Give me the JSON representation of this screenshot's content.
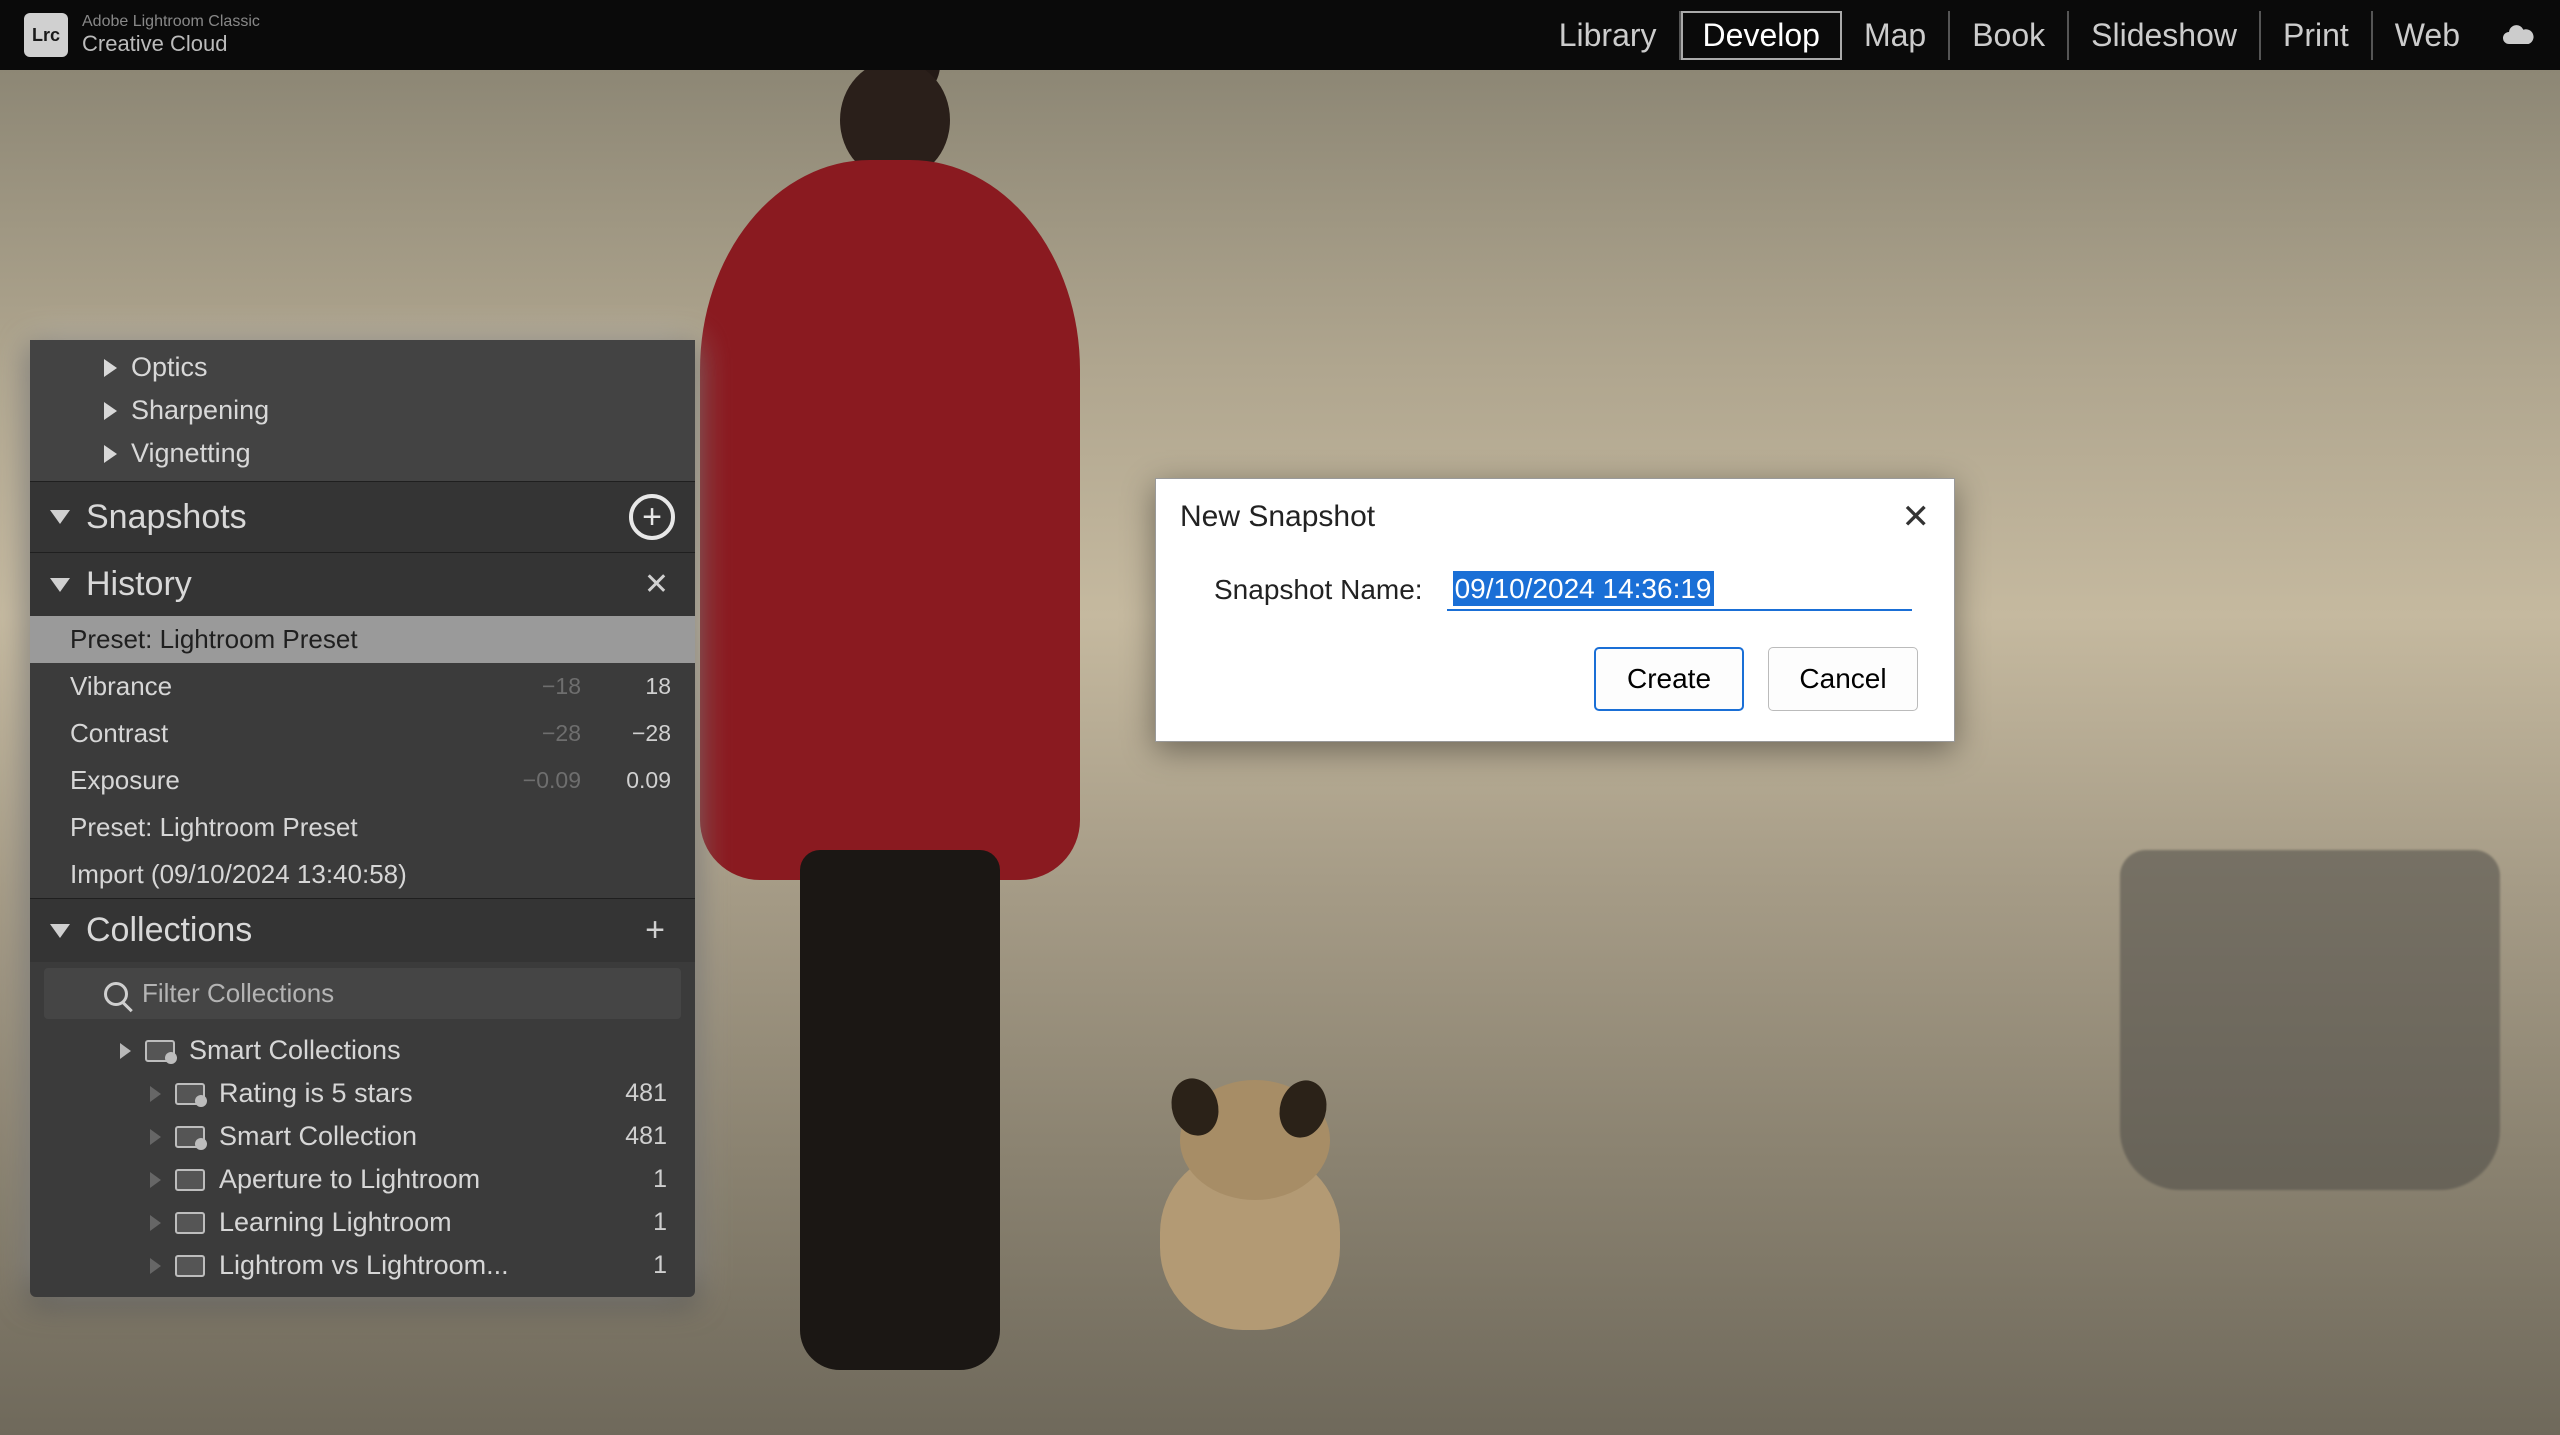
{
  "app": {
    "icon_label": "Lrc",
    "title_top": "Adobe Lightroom Classic",
    "title_bottom": "Creative Cloud"
  },
  "modules": {
    "items": [
      "Library",
      "Develop",
      "Map",
      "Book",
      "Slideshow",
      "Print",
      "Web"
    ],
    "active": "Develop"
  },
  "panel_top": {
    "items": [
      "Optics",
      "Sharpening",
      "Vignetting"
    ]
  },
  "snapshots": {
    "title": "Snapshots"
  },
  "history": {
    "title": "History",
    "items": [
      {
        "label": "Preset: Lightroom Preset",
        "v1": "",
        "v2": "",
        "selected": true
      },
      {
        "label": "Vibrance",
        "v1": "−18",
        "v2": "18"
      },
      {
        "label": "Contrast",
        "v1": "−28",
        "v2": "−28"
      },
      {
        "label": "Exposure",
        "v1": "−0.09",
        "v2": "0.09"
      },
      {
        "label": "Preset: Lightroom Preset",
        "v1": "",
        "v2": ""
      },
      {
        "label": "Import (09/10/2024 13:40:58)",
        "v1": "",
        "v2": ""
      }
    ]
  },
  "collections": {
    "title": "Collections",
    "filter_placeholder": "Filter Collections",
    "items": [
      {
        "name": "Smart Collections",
        "count": "",
        "icon": "smart",
        "arrow": "solid",
        "indent": 0
      },
      {
        "name": "Rating is 5 stars",
        "count": "481",
        "icon": "smart",
        "arrow": "dim",
        "indent": 1
      },
      {
        "name": "Smart Collection",
        "count": "481",
        "icon": "smart",
        "arrow": "dim",
        "indent": 1
      },
      {
        "name": "Aperture to Lightroom",
        "count": "1",
        "icon": "plain",
        "arrow": "dim",
        "indent": 1
      },
      {
        "name": "Learning Lightroom",
        "count": "1",
        "icon": "plain",
        "arrow": "dim",
        "indent": 1
      },
      {
        "name": "Lightrom vs Lightroom...",
        "count": "1",
        "icon": "plain",
        "arrow": "dim",
        "indent": 1
      }
    ]
  },
  "dialog": {
    "title": "New Snapshot",
    "label": "Snapshot Name:",
    "value": "09/10/2024 14:36:19",
    "create": "Create",
    "cancel": "Cancel"
  }
}
